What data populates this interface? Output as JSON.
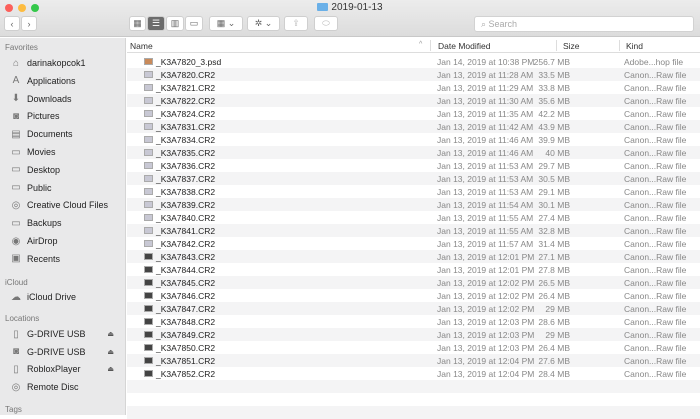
{
  "window": {
    "title": "2019-01-13",
    "search_placeholder": "Search"
  },
  "colors": {
    "close": "#fc605b",
    "minimize": "#fdbc40",
    "zoom": "#34c84a",
    "folder": "#6ab0e8"
  },
  "toolbar": {
    "back": "‹",
    "forward": "›",
    "view_icon": "▦",
    "view_list": "☰",
    "view_column": "▥",
    "view_gallery": "▭",
    "group": "▦ ⌄",
    "action": "✲ ⌄",
    "share": "⇪",
    "tag": "⬭"
  },
  "sidebar": {
    "favorites_label": "Favorites",
    "favorites": [
      {
        "label": "darinakopcok1",
        "icon": "⌂"
      },
      {
        "label": "Applications",
        "icon": "A"
      },
      {
        "label": "Downloads",
        "icon": "⬇"
      },
      {
        "label": "Pictures",
        "icon": "◙"
      },
      {
        "label": "Documents",
        "icon": "▤"
      },
      {
        "label": "Movies",
        "icon": "▭"
      },
      {
        "label": "Desktop",
        "icon": "▭"
      },
      {
        "label": "Public",
        "icon": "▭"
      },
      {
        "label": "Creative Cloud Files",
        "icon": "◎"
      },
      {
        "label": "Backups",
        "icon": "▭"
      },
      {
        "label": "AirDrop",
        "icon": "◉"
      },
      {
        "label": "Recents",
        "icon": "▣"
      }
    ],
    "icloud_label": "iCloud",
    "icloud": [
      {
        "label": "iCloud Drive",
        "icon": "☁"
      }
    ],
    "locations_label": "Locations",
    "locations": [
      {
        "label": "G-DRIVE USB",
        "icon": "▯",
        "eject": "⏏"
      },
      {
        "label": "G-DRIVE USB",
        "icon": "◙",
        "eject": "⏏"
      },
      {
        "label": "RobloxPlayer",
        "icon": "▯",
        "eject": "⏏"
      },
      {
        "label": "Remote Disc",
        "icon": "◎"
      }
    ],
    "tags_label": "Tags"
  },
  "columns": {
    "name": "Name",
    "date": "Date Modified",
    "size": "Size",
    "kind": "Kind",
    "sort_indicator": "^"
  },
  "files": [
    {
      "name": "_K3A7820_3.psd",
      "date": "Jan 14, 2019 at 10:38 PM",
      "size": "256.7 MB",
      "kind": "Adobe...hop file"
    },
    {
      "name": "_K3A7820.CR2",
      "date": "Jan 13, 2019 at 11:28 AM",
      "size": "33.5 MB",
      "kind": "Canon...Raw file"
    },
    {
      "name": "_K3A7821.CR2",
      "date": "Jan 13, 2019 at 11:29 AM",
      "size": "33.8 MB",
      "kind": "Canon...Raw file"
    },
    {
      "name": "_K3A7822.CR2",
      "date": "Jan 13, 2019 at 11:30 AM",
      "size": "35.6 MB",
      "kind": "Canon...Raw file"
    },
    {
      "name": "_K3A7824.CR2",
      "date": "Jan 13, 2019 at 11:35 AM",
      "size": "42.2 MB",
      "kind": "Canon...Raw file"
    },
    {
      "name": "_K3A7831.CR2",
      "date": "Jan 13, 2019 at 11:42 AM",
      "size": "43.9 MB",
      "kind": "Canon...Raw file"
    },
    {
      "name": "_K3A7834.CR2",
      "date": "Jan 13, 2019 at 11:46 AM",
      "size": "39.9 MB",
      "kind": "Canon...Raw file"
    },
    {
      "name": "_K3A7835.CR2",
      "date": "Jan 13, 2019 at 11:46 AM",
      "size": "40 MB",
      "kind": "Canon...Raw file"
    },
    {
      "name": "_K3A7836.CR2",
      "date": "Jan 13, 2019 at 11:53 AM",
      "size": "29.7 MB",
      "kind": "Canon...Raw file"
    },
    {
      "name": "_K3A7837.CR2",
      "date": "Jan 13, 2019 at 11:53 AM",
      "size": "30.5 MB",
      "kind": "Canon...Raw file"
    },
    {
      "name": "_K3A7838.CR2",
      "date": "Jan 13, 2019 at 11:53 AM",
      "size": "29.1 MB",
      "kind": "Canon...Raw file"
    },
    {
      "name": "_K3A7839.CR2",
      "date": "Jan 13, 2019 at 11:54 AM",
      "size": "30.1 MB",
      "kind": "Canon...Raw file"
    },
    {
      "name": "_K3A7840.CR2",
      "date": "Jan 13, 2019 at 11:55 AM",
      "size": "27.4 MB",
      "kind": "Canon...Raw file"
    },
    {
      "name": "_K3A7841.CR2",
      "date": "Jan 13, 2019 at 11:55 AM",
      "size": "32.8 MB",
      "kind": "Canon...Raw file"
    },
    {
      "name": "_K3A7842.CR2",
      "date": "Jan 13, 2019 at 11:57 AM",
      "size": "31.4 MB",
      "kind": "Canon...Raw file"
    },
    {
      "name": "_K3A7843.CR2",
      "date": "Jan 13, 2019 at 12:01 PM",
      "size": "27.1 MB",
      "kind": "Canon...Raw file"
    },
    {
      "name": "_K3A7844.CR2",
      "date": "Jan 13, 2019 at 12:01 PM",
      "size": "27.8 MB",
      "kind": "Canon...Raw file"
    },
    {
      "name": "_K3A7845.CR2",
      "date": "Jan 13, 2019 at 12:02 PM",
      "size": "26.5 MB",
      "kind": "Canon...Raw file"
    },
    {
      "name": "_K3A7846.CR2",
      "date": "Jan 13, 2019 at 12:02 PM",
      "size": "26.4 MB",
      "kind": "Canon...Raw file"
    },
    {
      "name": "_K3A7847.CR2",
      "date": "Jan 13, 2019 at 12:02 PM",
      "size": "29 MB",
      "kind": "Canon...Raw file"
    },
    {
      "name": "_K3A7848.CR2",
      "date": "Jan 13, 2019 at 12:03 PM",
      "size": "28.6 MB",
      "kind": "Canon...Raw file"
    },
    {
      "name": "_K3A7849.CR2",
      "date": "Jan 13, 2019 at 12:03 PM",
      "size": "29 MB",
      "kind": "Canon...Raw file"
    },
    {
      "name": "_K3A7850.CR2",
      "date": "Jan 13, 2019 at 12:03 PM",
      "size": "26.4 MB",
      "kind": "Canon...Raw file"
    },
    {
      "name": "_K3A7851.CR2",
      "date": "Jan 13, 2019 at 12:04 PM",
      "size": "27.6 MB",
      "kind": "Canon...Raw file"
    },
    {
      "name": "_K3A7852.CR2",
      "date": "Jan 13, 2019 at 12:04 PM",
      "size": "28.4 MB",
      "kind": "Canon...Raw file"
    }
  ]
}
